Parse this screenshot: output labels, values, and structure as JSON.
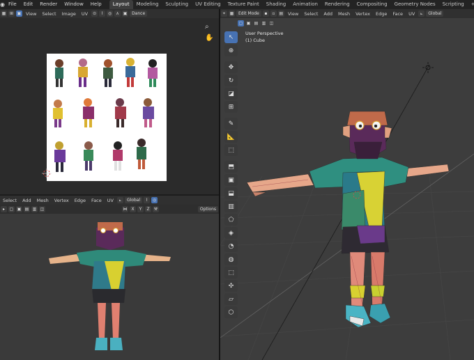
{
  "topbar": {
    "menus": [
      "File",
      "Edit",
      "Render",
      "Window",
      "Help"
    ],
    "workspaces": [
      "Layout",
      "Modeling",
      "Sculpting",
      "UV Editing",
      "Texture Paint",
      "Shading",
      "Animation",
      "Rendering",
      "Compositing",
      "Geometry Nodes",
      "Scripting"
    ],
    "active_workspace": "Layout",
    "add_tab": "+"
  },
  "uv_editor": {
    "header_menus": [
      "View",
      "Select",
      "Image",
      "UV"
    ],
    "image_name": "Dance",
    "icons": [
      "zoom-icon",
      "hand-icon"
    ]
  },
  "viewport_small": {
    "header_menus": [
      "Select",
      "Add",
      "Mesh",
      "Vertex",
      "Edge",
      "Face",
      "UV"
    ],
    "orientation": "Global",
    "axes": [
      "X",
      "Y",
      "Z"
    ],
    "options_label": "Options"
  },
  "viewport_main": {
    "mode": "Edit Mode",
    "header_menus": [
      "View",
      "Select",
      "Add",
      "Mesh",
      "Vertex",
      "Edge",
      "Face",
      "UV"
    ],
    "orientation": "Global",
    "overlay_title": "User Perspective",
    "overlay_object": "(1) Cube"
  },
  "colors": {
    "accent": "#4772b3",
    "background": "#1d1d1d",
    "panel": "#303030",
    "viewport": "#3d3d3d"
  }
}
